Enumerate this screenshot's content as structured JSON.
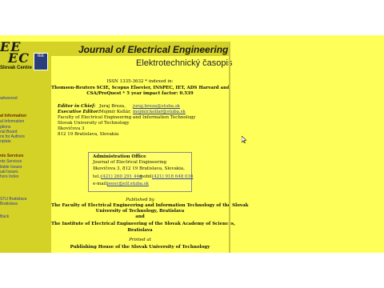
{
  "logo": {
    "lines": [
      "EE",
      "EC"
    ],
    "caption": "Slovak Centre of",
    "badge": "IEE"
  },
  "sidebar": {
    "items": [
      {
        "label": "advanced",
        "kind": "link"
      },
      {
        "label": "al Information",
        "kind": "head"
      },
      {
        "label": "al Information",
        "kind": "link"
      },
      {
        "label": "ptions",
        "kind": "link"
      },
      {
        "label": "rial Board",
        "kind": "link"
      },
      {
        "label": "ns for Authors",
        "kind": "link"
      },
      {
        "label": "nplate",
        "kind": "link"
      },
      {
        "label": "nts Services",
        "kind": "head"
      },
      {
        "label": "nts Services",
        "kind": "link"
      },
      {
        "label": "ilable Issues",
        "kind": "link"
      },
      {
        "label": "ual Issues",
        "kind": "link"
      },
      {
        "label": "hors Index",
        "kind": "link"
      },
      {
        "label": "STU Bratislava",
        "kind": "link"
      },
      {
        "label": "Bratislava",
        "kind": "link"
      },
      {
        "label": "Back",
        "kind": "link"
      }
    ]
  },
  "header": {
    "title": "Journal of Electrical Engineering",
    "subtitle": "Elektrotechnický časopis"
  },
  "info": {
    "issn": "ISSN 1335-3632 * indexed in:",
    "indexed_line1": "Thomson-Reuters SCIE, Scopus Elsevier, INSPEC, IET, ADS Harvard and",
    "indexed_line2": "CSA/ProQuest * 5 year impact factor: 0.539"
  },
  "editors": {
    "chief_label": "Editor in Chief:",
    "chief_name": "Juraj Breza,",
    "chief_email": "juraj.breza@stuba.sk",
    "exec_label": "Executive Editor:",
    "exec_name": "Mojmír Kollár,",
    "exec_email": "mojmir.kollar@stuba.sk",
    "addr1": "Faculty of Electrical Engineering and Information Technology",
    "addr2": "Slovak University of Technology",
    "addr3": "Ilkovičova 3",
    "addr4": "812 19 Bratislava, Slovakia"
  },
  "admin": {
    "title": "Administration Office",
    "line1": "Journal of Electrical Engineering",
    "line2": "Ilkovičova 3, 812 19 Bratislava, Slovakia,",
    "tel_label": "tel.:",
    "tel": "(421) 260 291 444",
    "mobil_label": "mobil:",
    "mobil": "(421) 918 648 016",
    "email_label": "e-mail:",
    "email": "jeeec@elf.stuba.sk"
  },
  "publisher": {
    "published_by": "Published by",
    "fac1": "The Faculty of Electrical Engineering and Information Technology of the Slovak",
    "fac2": "University of Technology, Bratislava",
    "and": "and",
    "inst1": "The Institute of Electrical Engineering of the Slovak Academy of Sciences,",
    "inst2": "Bratislava",
    "printed_at": "Printed at",
    "house": "Publishing House of the Slovak University of Technology"
  },
  "colors": {
    "page_bg": "#ffff5a",
    "sidebar_bg": "#d4d226",
    "link": "#3040a0"
  }
}
